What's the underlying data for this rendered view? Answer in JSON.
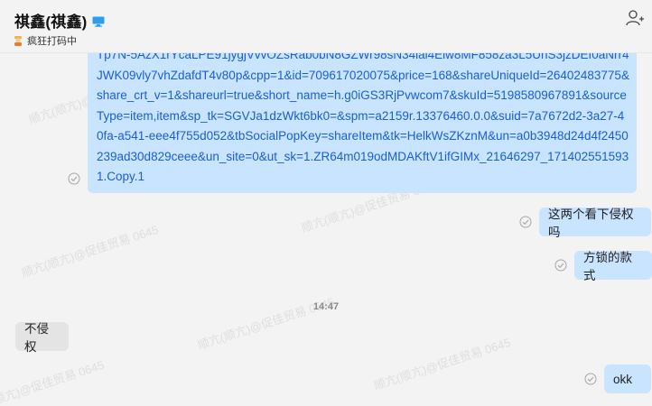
{
  "header": {
    "title": "祺鑫(祺鑫)",
    "status_text": "疯狂打码中"
  },
  "messages": {
    "long_link": "Tp7N-5AzX1rYcaLPE91jygjVvvOZsRab0bN8GZWr98sN34lai4Elw8MF858za3L5UhS3jzDEf0aNrr4JWK09vly7vhZdafdT4v80p&cpp=1&id=709617020075&price=168&shareUniqueId=26402483775&share_crt_v=1&shareurl=true&short_name=h.g0iGS3RjPvwcom7&skuId=5198580967891&sourceType=item,item&sp_tk=SGVJa1dzWkt6bk0=&spm=a2159r.13376460.0.0&suid=7a7672d2-3a27-40fa-a541-eee4f755d052&tbSocialPopKey=shareItem&tk=HelkWsZKznM&un=a0b3948d24d4f2450239ad30d829ceee&un_site=0&ut_sk=1.ZR64m019odMDAKftV1ifGIMx_21646297_1714025515931.Copy.1",
    "msg_1": "这两个看下侵权吗",
    "msg_2": "方锁的款式",
    "timestamp": "14:47",
    "reply_1": "不侵权",
    "msg_3": "okk"
  },
  "watermark_text": "顺亢(顺亢)@促佳贸易 0645",
  "colors": {
    "bubble_self": "#c9e4ff",
    "bubble_other": "#e4e4e4",
    "link": "#1a5fd1",
    "background": "#f3f3f3"
  },
  "icons": {
    "device": "monitor-icon",
    "status": "worker-emoji-icon",
    "add_user": "add-user-icon",
    "read_receipt": "check-circle-icon"
  }
}
